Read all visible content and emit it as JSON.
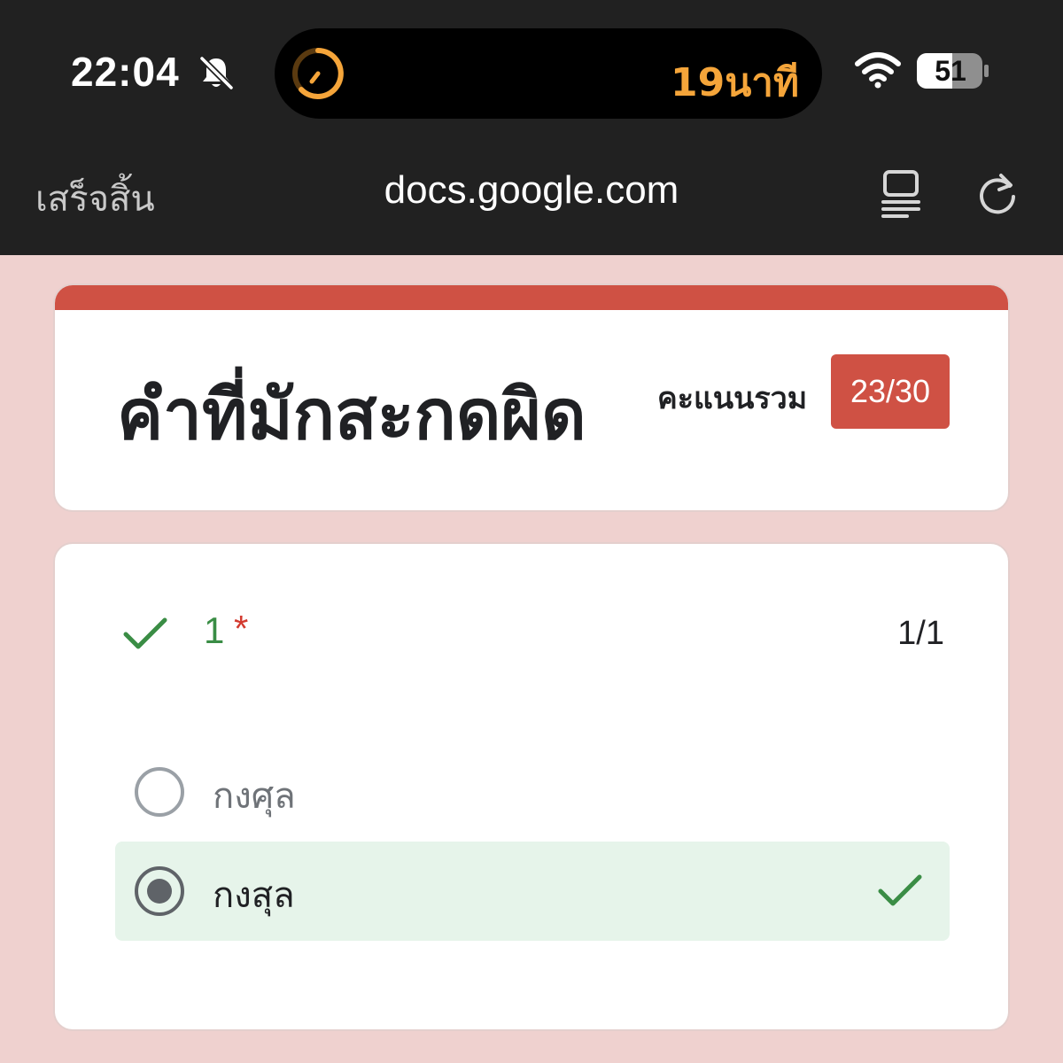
{
  "status_bar": {
    "time": "22:04",
    "timer_text": "19นาที",
    "battery": "51",
    "icons": [
      "bell-slash-icon",
      "timer-icon",
      "wifi-icon",
      "battery-icon"
    ]
  },
  "browser": {
    "done_label": "เสร็จสิ้น",
    "url": "docs.google.com",
    "icons": [
      "reader-icon",
      "reload-icon"
    ]
  },
  "quiz": {
    "title": "คำที่มักสะกดผิด",
    "score_label": "คะแนนรวม",
    "score": "23/30",
    "accent_color": "#cf5144"
  },
  "question": {
    "number": "1",
    "required_mark": "*",
    "points": "1/1",
    "status": "correct",
    "options": [
      {
        "label": "กงศุล",
        "selected": false
      },
      {
        "label": "กงสุล",
        "selected": true,
        "correct": true
      }
    ],
    "correct_color": "#3a8d45",
    "correct_bg": "#e6f4ea"
  }
}
